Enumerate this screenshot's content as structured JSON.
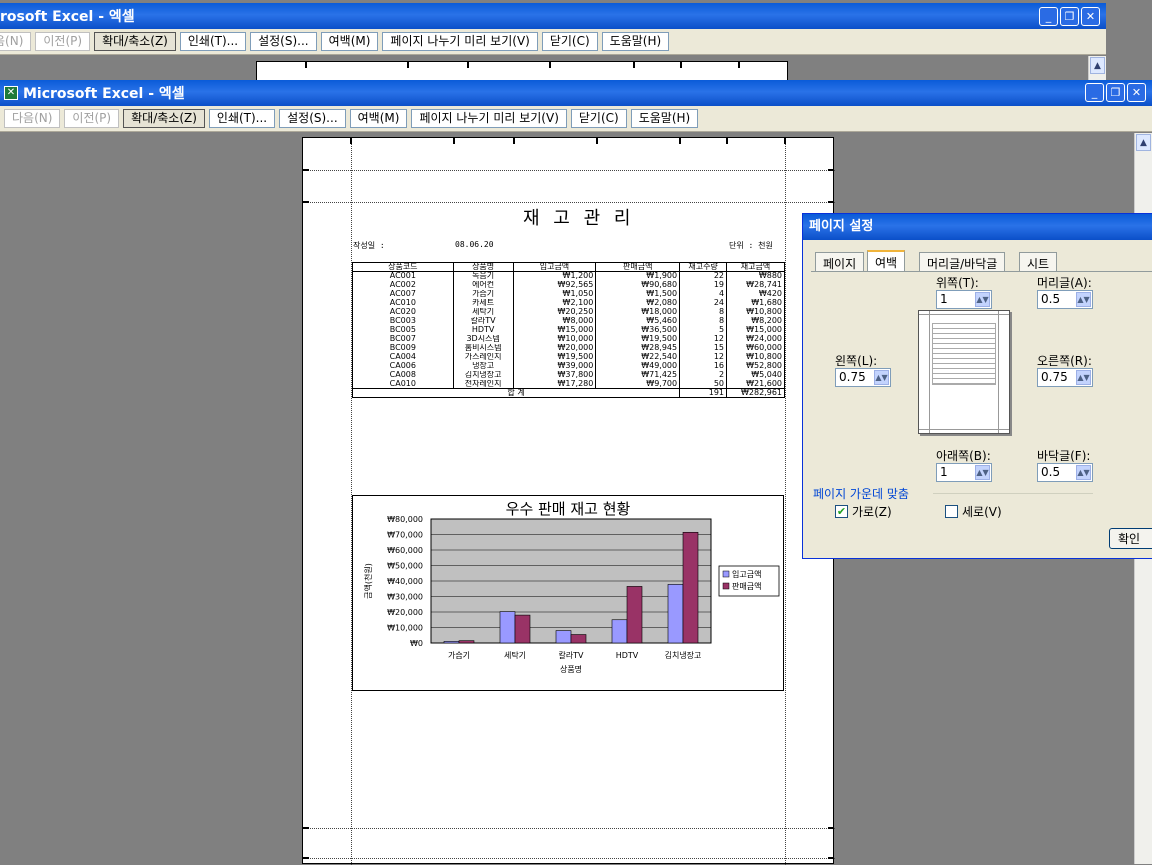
{
  "back_window": {
    "title": "rosoft Excel - 엑셀",
    "toolbar": {
      "next_label": "음(N)",
      "prev_label": "이전(P)",
      "zoom_label": "확대/축소(Z)",
      "print_label": "인쇄(T)...",
      "setup_label": "설정(S)...",
      "margins_label": "여백(M)",
      "pagebreak_label": "페이지 나누기 미리 보기(V)",
      "close_label": "닫기(C)",
      "help_label": "도움말(H)"
    }
  },
  "window": {
    "title": "Microsoft Excel - 엑셀",
    "toolbar": {
      "next_label": "다음(N)",
      "prev_label": "이전(P)",
      "zoom_label": "확대/축소(Z)",
      "print_label": "인쇄(T)...",
      "setup_label": "설정(S)...",
      "margins_label": "여백(M)",
      "pagebreak_label": "페이지 나누기 미리 보기(V)",
      "close_label": "닫기(C)",
      "help_label": "도움말(H)"
    }
  },
  "sheet": {
    "title": "재 고 관 리",
    "created_label": "작성일 :",
    "created_date": "08.06.20",
    "unit_label": "단위 : 천원",
    "headers": [
      "상품코드",
      "상품명",
      "입고금액",
      "판매금액",
      "재고수량",
      "재고금액"
    ],
    "rows": [
      [
        "AC001",
        "녹음기",
        "₩1,200",
        "₩1,900",
        "22",
        "₩880"
      ],
      [
        "AC002",
        "에어컨",
        "₩92,565",
        "₩90,680",
        "19",
        "₩28,741"
      ],
      [
        "AC007",
        "가습기",
        "₩1,050",
        "₩1,500",
        "4",
        "₩420"
      ],
      [
        "AC010",
        "카세트",
        "₩2,100",
        "₩2,080",
        "24",
        "₩1,680"
      ],
      [
        "AC020",
        "세탁기",
        "₩20,250",
        "₩18,000",
        "8",
        "₩10,800"
      ],
      [
        "BC003",
        "칼라TV",
        "₩8,000",
        "₩5,460",
        "8",
        "₩8,200"
      ],
      [
        "BC005",
        "HDTV",
        "₩15,000",
        "₩36,500",
        "5",
        "₩15,000"
      ],
      [
        "BC007",
        "3D시스템",
        "₩10,000",
        "₩19,500",
        "12",
        "₩24,000"
      ],
      [
        "BC009",
        "홈비시스템",
        "₩20,000",
        "₩28,945",
        "15",
        "₩60,000"
      ],
      [
        "CA004",
        "가스레인지",
        "₩19,500",
        "₩22,540",
        "12",
        "₩10,800"
      ],
      [
        "CA006",
        "냉장고",
        "₩39,000",
        "₩49,000",
        "16",
        "₩52,800"
      ],
      [
        "CA008",
        "김치냉장고",
        "₩37,800",
        "₩71,425",
        "2",
        "₩5,040"
      ],
      [
        "CA010",
        "전자레인지",
        "₩17,280",
        "₩9,700",
        "50",
        "₩21,600"
      ]
    ],
    "total_label": "합    계",
    "total_qty": "191",
    "total_amount": "₩282,961"
  },
  "chart_data": {
    "type": "bar",
    "title": "우수 판매 재고 현황",
    "xlabel": "상품명",
    "ylabel": "금액(천원)",
    "categories": [
      "가습기",
      "세탁기",
      "칼라TV",
      "HDTV",
      "김치냉장고"
    ],
    "series": [
      {
        "name": "입고금액",
        "values": [
          1050,
          20250,
          8000,
          15000,
          37800
        ],
        "color": "#9999ff"
      },
      {
        "name": "판매금액",
        "values": [
          1500,
          18000,
          5460,
          36500,
          71425
        ],
        "color": "#993366"
      }
    ],
    "ylim": [
      0,
      80000
    ],
    "yticks": [
      "₩0",
      "₩10,000",
      "₩20,000",
      "₩30,000",
      "₩40,000",
      "₩50,000",
      "₩60,000",
      "₩70,000",
      "₩80,000"
    ],
    "grid": true,
    "legend": "right",
    "plot_bg": "#c0c0c0"
  },
  "dialog": {
    "title": "페이지 설정",
    "tabs": [
      "페이지",
      "여백",
      "머리글/바닥글",
      "시트"
    ],
    "top_label": "위쪽(T):",
    "top_value": "1",
    "header_label": "머리글(A):",
    "header_value": "0.5",
    "left_label": "왼쪽(L):",
    "left_value": "0.75",
    "right_label": "오른쪽(R):",
    "right_value": "0.75",
    "bottom_label": "아래쪽(B):",
    "bottom_value": "1",
    "footer_label": "바닥글(F):",
    "footer_value": "0.5",
    "center_group_label": "페이지 가운데 맞춤",
    "horizontal_label": "가로(Z)",
    "vertical_label": "세로(V)",
    "horizontal_checked": true,
    "vertical_checked": false,
    "ok_label": "확인"
  }
}
